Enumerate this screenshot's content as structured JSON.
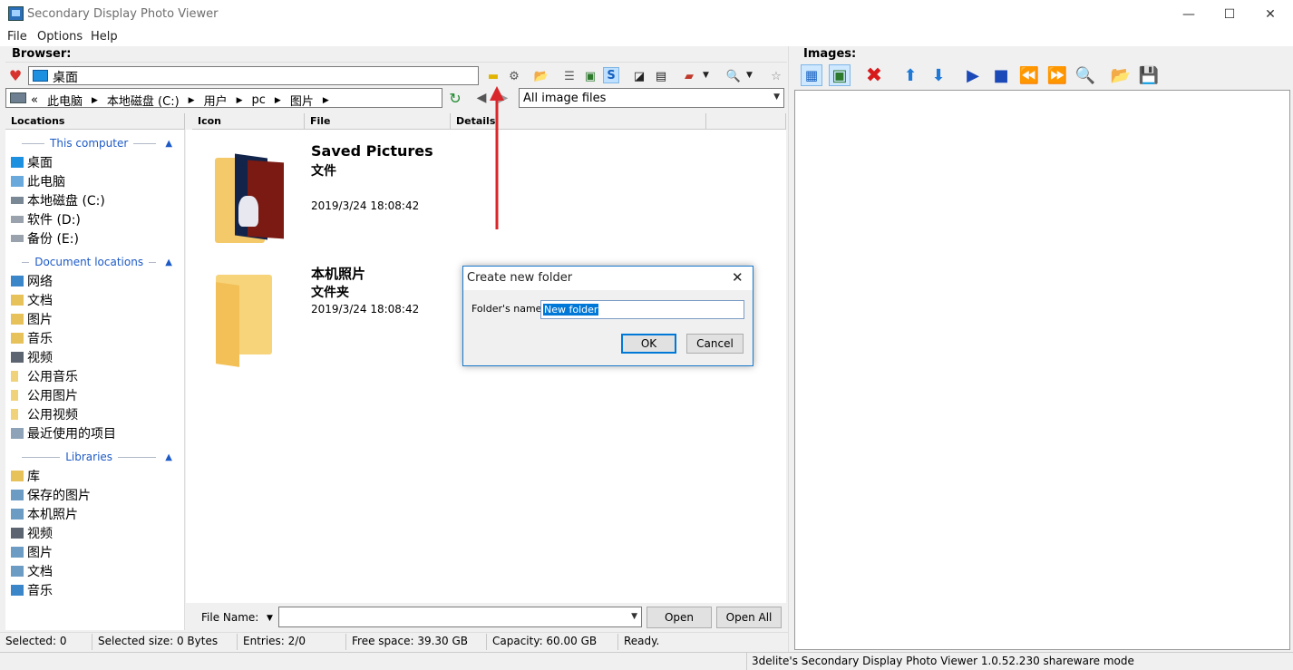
{
  "window": {
    "title": "Secondary Display Photo Viewer",
    "minimize": "—",
    "maximize": "☐",
    "close": "✕"
  },
  "menu": {
    "file": "File",
    "options": "Options",
    "help": "Help"
  },
  "browser": {
    "label": "Browser:",
    "address": "桌面",
    "breadcrumb": {
      "prefix": "«",
      "items": [
        "此电脑",
        "本地磁盘 (C:)",
        "用户",
        "pc",
        "图片"
      ]
    },
    "filter": "All image files"
  },
  "columns": {
    "locations": "Locations",
    "icon": "Icon",
    "file": "File",
    "details": "Details"
  },
  "locations": {
    "group_computer": "This computer",
    "computer_items": [
      "桌面",
      "此电脑",
      "本地磁盘 (C:)",
      "软件 (D:)",
      "备份 (E:)"
    ],
    "group_documents": "Document locations",
    "document_items": [
      "网络",
      "文档",
      "图片",
      "音乐",
      "视频",
      "公用音乐",
      "公用图片",
      "公用视频",
      "最近使用的项目"
    ],
    "group_libraries": "Libraries",
    "library_items": [
      "库",
      "保存的图片",
      "本机照片",
      "视频",
      "图片",
      "文档",
      "音乐"
    ]
  },
  "files": [
    {
      "name": "Saved Pictures",
      "type": "文件",
      "date": "2019/3/24 18:08:42"
    },
    {
      "name": "本机照片",
      "type": "文件夹",
      "date": "2019/3/24 18:08:42"
    }
  ],
  "bottom": {
    "file_name_label": "File Name:",
    "open": "Open",
    "open_all": "Open All"
  },
  "status": {
    "selected": "Selected: 0",
    "selected_size": "Selected size: 0 Bytes",
    "entries": "Entries: 2/0",
    "free_space": "Free space: 39.30 GB",
    "capacity": "Capacity: 60.00 GB",
    "state": "Ready.",
    "footer": "3delite's Secondary Display Photo Viewer 1.0.52.230 shareware mode"
  },
  "images": {
    "label": "Images:"
  },
  "dialog": {
    "title": "Create new folder",
    "name_label": "Folder's name:",
    "name_value": "New folder",
    "ok": "OK",
    "cancel": "Cancel"
  },
  "colors": {
    "accent": "#1d5ac6",
    "annotation_arrow": "#d9262b",
    "selection": "#0078d7"
  }
}
